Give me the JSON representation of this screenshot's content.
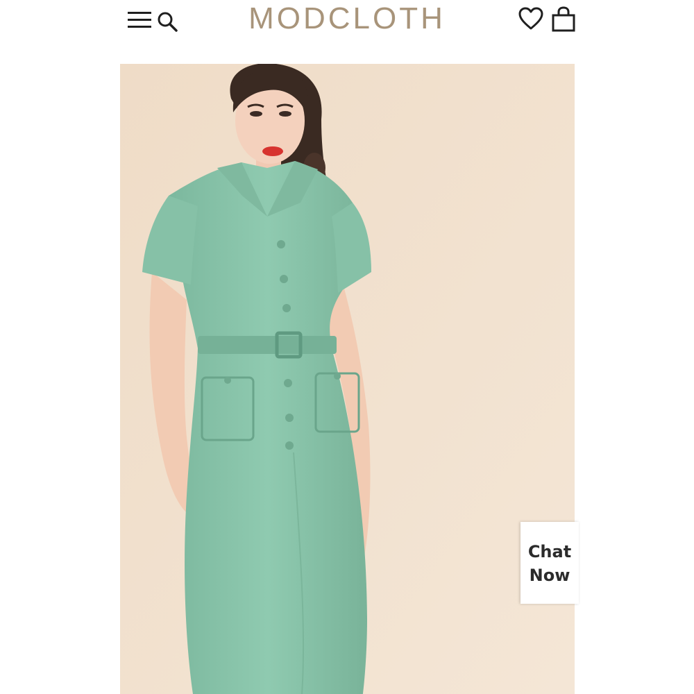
{
  "header": {
    "brand": "MODCLOTH",
    "menu_icon": "hamburger-menu-icon",
    "search_icon": "search-icon",
    "wishlist_icon": "heart-icon",
    "bag_icon": "shopping-bag-icon"
  },
  "product_image": {
    "alt": "Model wearing a mint green belted shirt dress"
  },
  "chat": {
    "line1": "Chat",
    "line2": "Now"
  },
  "colors": {
    "brand": "#a8947a",
    "dress": "#88c4aa",
    "background": "#f1dfcb"
  }
}
